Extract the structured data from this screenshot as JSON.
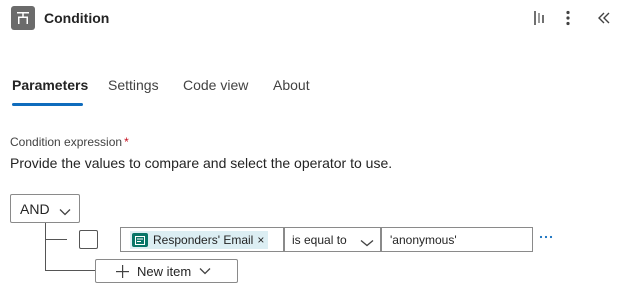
{
  "header": {
    "title": "Condition",
    "icon": "condition-icon",
    "actions": [
      "split-view-icon",
      "more-vertical-icon",
      "collapse-icon"
    ]
  },
  "tabs": [
    {
      "label": "Parameters",
      "active": true
    },
    {
      "label": "Settings",
      "active": false
    },
    {
      "label": "Code view",
      "active": false
    },
    {
      "label": "About",
      "active": false
    }
  ],
  "condition": {
    "label": "Condition expression",
    "required_marker": "*",
    "description": "Provide the values to compare and select the operator to use.",
    "group_operator": "AND",
    "rows": [
      {
        "left_token": "Responders' Email",
        "token_remove": "×",
        "operator": "is equal to",
        "right_value": "'anonymous'"
      }
    ],
    "new_item_label": "New item"
  },
  "colors": {
    "accent": "#0f6cbd",
    "required": "#c50f1f",
    "token_bg": "#dceef3",
    "token_icon": "#077568"
  }
}
